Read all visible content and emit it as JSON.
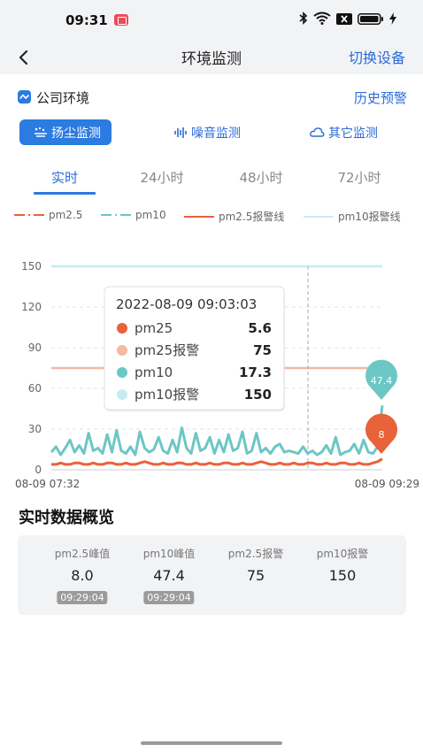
{
  "status_bar": {
    "time": "09:31"
  },
  "nav": {
    "title": "环境监测",
    "switch_label": "切换设备"
  },
  "company": {
    "label": "公司环境",
    "history_label": "历史预警"
  },
  "monitor_tabs": [
    {
      "label": "扬尘监测",
      "icon": "dust-icon",
      "active": true
    },
    {
      "label": "噪音监测",
      "icon": "sound-wave-icon",
      "active": false
    },
    {
      "label": "其它监测",
      "icon": "cloud-icon",
      "active": false
    }
  ],
  "time_tabs": [
    {
      "label": "实时",
      "active": true
    },
    {
      "label": "24小时",
      "active": false
    },
    {
      "label": "48小时",
      "active": false
    },
    {
      "label": "72小时",
      "active": false
    }
  ],
  "legend": [
    {
      "label": "pm2.5",
      "color": "#e8623a",
      "style": "dash-dot"
    },
    {
      "label": "pm10",
      "color": "#6cc7c4",
      "style": "dash-dot"
    },
    {
      "label": "pm2.5报警线",
      "color": "#e8623a",
      "style": "solid"
    },
    {
      "label": "pm10报警线",
      "color": "#c7ebf4",
      "style": "solid"
    }
  ],
  "chart_data": {
    "type": "line",
    "x_start_label": "08-09 07:32",
    "x_end_label": "08-09 09:29",
    "ylim": [
      0,
      150
    ],
    "y_ticks": [
      0,
      30,
      60,
      90,
      120,
      150
    ],
    "grid": true,
    "series": [
      {
        "name": "pm2.5",
        "color": "#e8623a",
        "values": [
          4,
          4,
          5,
          4,
          4,
          5,
          5,
          4,
          4,
          5,
          4,
          4,
          5,
          5,
          4,
          4,
          5,
          4,
          4,
          5,
          6,
          5,
          4,
          4,
          5,
          4,
          4,
          5,
          5,
          4,
          4,
          5,
          4,
          4,
          5,
          4,
          4,
          5,
          5,
          4,
          4,
          5,
          4,
          4,
          5,
          6,
          5,
          4,
          4,
          5,
          4,
          4,
          5,
          4,
          4,
          5,
          5,
          4,
          4,
          5,
          4,
          4,
          5,
          5,
          4,
          4,
          5,
          4,
          4,
          5,
          6,
          8
        ]
      },
      {
        "name": "pm10",
        "color": "#6cc7c4",
        "values": [
          13,
          17,
          11,
          16,
          22,
          13,
          18,
          12,
          27,
          14,
          16,
          12,
          26,
          13,
          29,
          14,
          12,
          17,
          11,
          28,
          16,
          13,
          15,
          24,
          14,
          12,
          22,
          13,
          31,
          16,
          12,
          27,
          14,
          16,
          24,
          12,
          22,
          13,
          26,
          14,
          16,
          28,
          12,
          14,
          27,
          13,
          16,
          12,
          17,
          19,
          13,
          14,
          13,
          12,
          17,
          12,
          14,
          11,
          13,
          18,
          12,
          24,
          11,
          13,
          14,
          19,
          12,
          22,
          13,
          12,
          17,
          47.4
        ]
      },
      {
        "name": "pm2.5报警线",
        "color": "#f4b8a4",
        "value": 75
      },
      {
        "name": "pm10报警线",
        "color": "#c7ebf4",
        "value": 150
      }
    ],
    "marker_pm10": "47.4",
    "marker_pm25": "8"
  },
  "tooltip": {
    "time": "2022-08-09 09:03:03",
    "rows": [
      {
        "label": "pm25",
        "value": "5.6",
        "color": "#e8623a"
      },
      {
        "label": "pm25报警",
        "value": "75",
        "color": "#f4b8a4"
      },
      {
        "label": "pm10",
        "value": "17.3",
        "color": "#6cc7c4"
      },
      {
        "label": "pm10报警",
        "value": "150",
        "color": "#c7ebf4"
      }
    ]
  },
  "overview": {
    "title": "实时数据概览",
    "columns": [
      {
        "label": "pm2.5峰值",
        "value": "8.0",
        "time": "09:29:04"
      },
      {
        "label": "pm10峰值",
        "value": "47.4",
        "time": "09:29:04"
      },
      {
        "label": "pm2.5报警",
        "value": "75"
      },
      {
        "label": "pm10报警",
        "value": "150"
      }
    ]
  }
}
